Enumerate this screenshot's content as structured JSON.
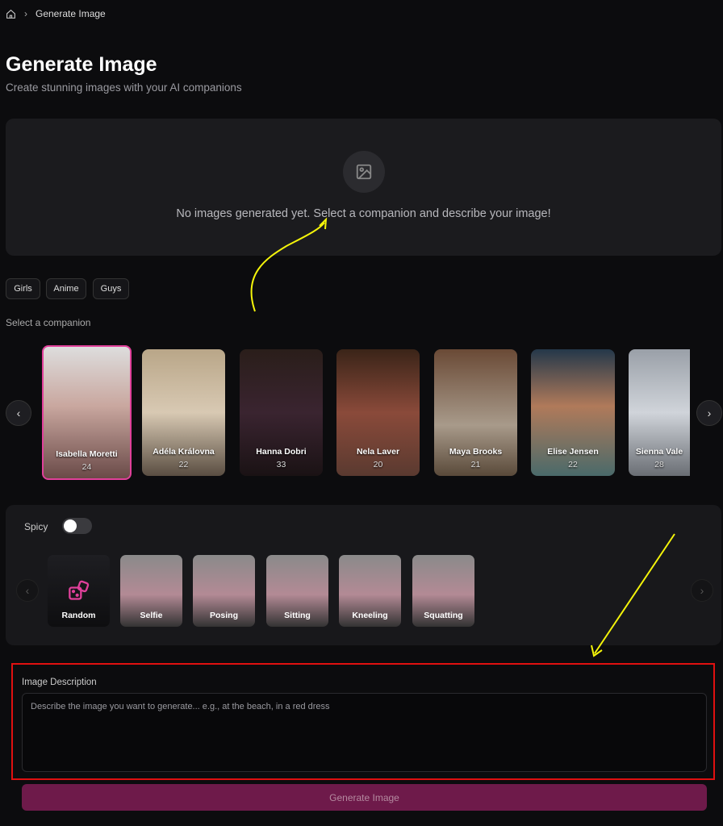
{
  "breadcrumb": {
    "home_icon": "home-icon",
    "current": "Generate Image"
  },
  "header": {
    "title": "Generate Image",
    "subtitle": "Create stunning images with your AI companions"
  },
  "empty_state": {
    "icon": "image-icon",
    "message": "No images generated yet. Select a companion and describe your image!"
  },
  "filters": [
    "Girls",
    "Anime",
    "Guys"
  ],
  "companion_label": "Select a companion",
  "companions": [
    {
      "name": "Isabella Moretti",
      "age": "24",
      "selected": true
    },
    {
      "name": "Adéla Královna",
      "age": "22"
    },
    {
      "name": "Hanna Dobri",
      "age": "33"
    },
    {
      "name": "Nela Laver",
      "age": "20"
    },
    {
      "name": "Maya Brooks",
      "age": "21"
    },
    {
      "name": "Elise Jensen",
      "age": "22"
    },
    {
      "name": "Sienna Vale",
      "age": "28"
    }
  ],
  "spicy": {
    "label": "Spicy",
    "on": false
  },
  "poses": [
    "Random",
    "Selfie",
    "Posing",
    "Sitting",
    "Kneeling",
    "Squatting"
  ],
  "description": {
    "label": "Image Description",
    "placeholder": "Describe the image you want to generate... e.g., at the beach, in a red dress",
    "value": ""
  },
  "generate_button": "Generate Image",
  "colors": {
    "accent": "#e0409a",
    "button": "#6e1a4a",
    "annotation_arrow": "#f4f40a",
    "annotation_box": "#e01010"
  }
}
